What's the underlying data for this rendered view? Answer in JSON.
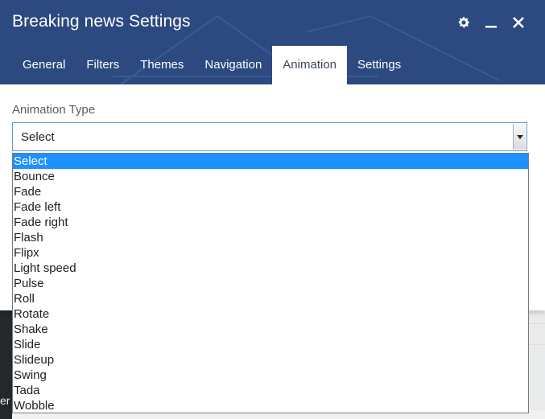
{
  "dialog": {
    "title": "Breaking news Settings",
    "icons": [
      "gear-icon",
      "minimize-icon",
      "close-icon"
    ],
    "tabs": [
      {
        "label": "General",
        "active": false
      },
      {
        "label": "Filters",
        "active": false
      },
      {
        "label": "Themes",
        "active": false
      },
      {
        "label": "Navigation",
        "active": false
      },
      {
        "label": "Animation",
        "active": true
      },
      {
        "label": "Settings",
        "active": false
      }
    ]
  },
  "animation": {
    "label": "Animation Type",
    "selected": "Select",
    "options": [
      "Select",
      "Bounce",
      "Fade",
      "Fade left",
      "Fade right",
      "Flash",
      "Flipx",
      "Light speed",
      "Pulse",
      "Roll",
      "Rotate",
      "Shake",
      "Slide",
      "Slideup",
      "Swing",
      "Tada",
      "Wobble"
    ]
  },
  "background": {
    "fragment_text": "er"
  },
  "colors": {
    "header": "#2c4a80",
    "selection": "#1e90ff",
    "focus_border": "#5b9dd9"
  }
}
